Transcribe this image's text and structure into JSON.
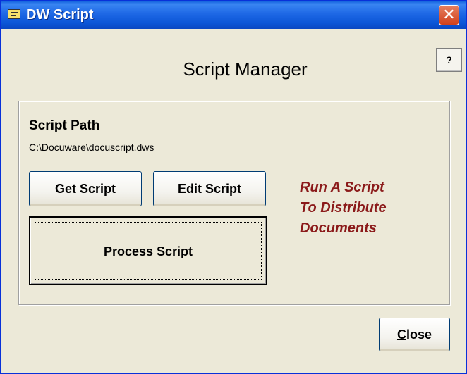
{
  "window": {
    "title": "DW Script",
    "close_glyph": "✕",
    "help_label": "?"
  },
  "main": {
    "heading": "Script Manager",
    "script_path_label": "Script Path",
    "script_path_value": "C:\\Docuware\\docuscript.dws",
    "note_lines": [
      "Run A Script",
      "To Distribute",
      "Documents"
    ]
  },
  "buttons": {
    "get_script": "Get Script",
    "edit_script": "Edit Script",
    "process_script": "Process Script",
    "close_first": "C",
    "close_rest": "lose"
  },
  "icons": {
    "app_icon": "notepad-icon",
    "close_icon": "close-icon"
  },
  "colors": {
    "titlebar": "#0b55d6",
    "window_bg": "#ece9d8",
    "note_text": "#8b1a1a"
  }
}
